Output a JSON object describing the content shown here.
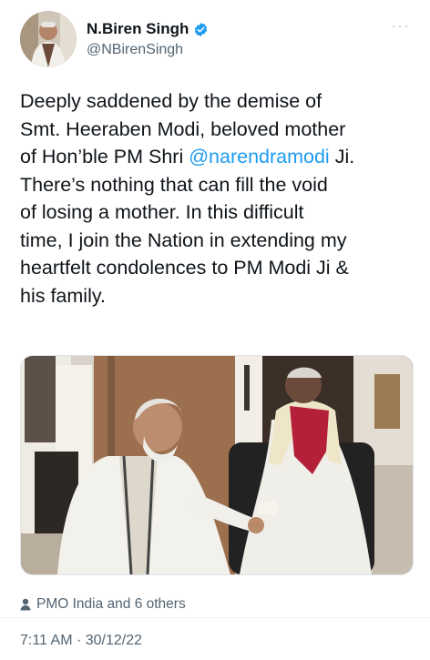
{
  "author": {
    "display_name": "N.Biren Singh",
    "handle": "@NBirenSingh"
  },
  "tweet": {
    "text_before": "Deeply saddened by the demise of\nSmt. Heeraben Modi, beloved mother\nof Hon’ble PM Shri ",
    "mention": "@narendramodi",
    "text_after": " Ji.\nThere’s nothing that can fill the void\nof losing a mother. In this difficult\ntime, I join the Nation in extending my\nheartfelt condolences to PM Modi Ji &\nhis family."
  },
  "liked_by": "PMO India and 6 others",
  "timestamp": "7:11 AM · 30/12/22",
  "colors": {
    "link": "#1d9bf0",
    "verified_badge": "#1d9bf0",
    "secondary_text": "#536471"
  },
  "icons": {
    "verified": "verified-badge-icon",
    "more": "more-options-icon",
    "likes": "person-icon"
  }
}
